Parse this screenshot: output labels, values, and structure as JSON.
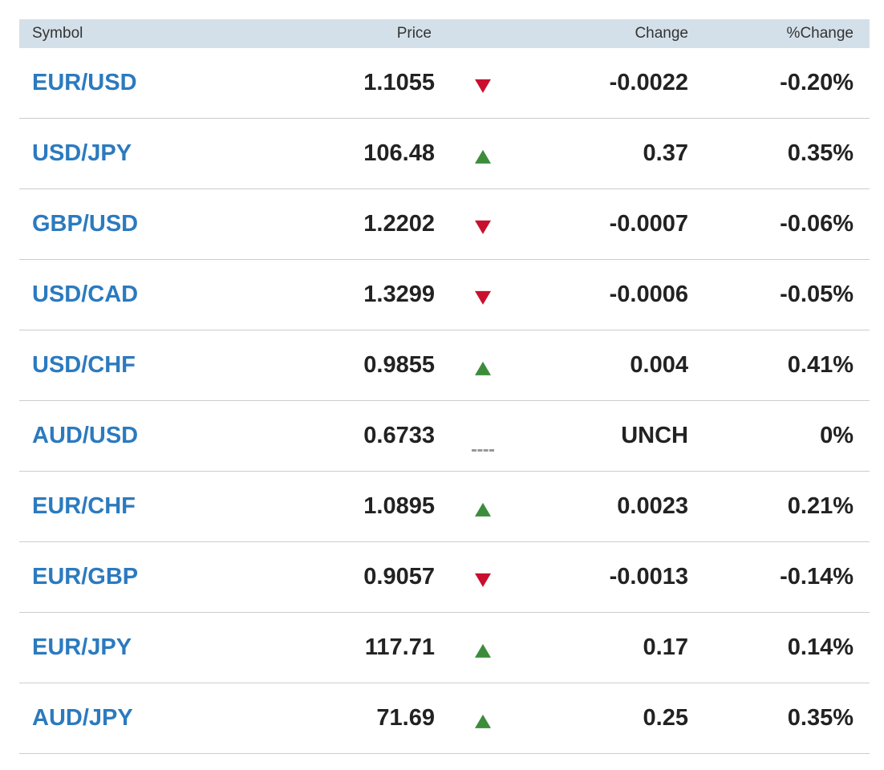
{
  "table": {
    "headers": {
      "symbol": "Symbol",
      "price": "Price",
      "change": "Change",
      "pct_change": "%Change"
    },
    "colors": {
      "header_bg": "#d4e0e9",
      "symbol_link": "#2b7abf",
      "down": "#c8102e",
      "up": "#3c8c3c",
      "unchanged": "#999999"
    },
    "rows": [
      {
        "symbol": "EUR/USD",
        "price": "1.1055",
        "direction": "down",
        "change": "-0.0022",
        "pct_change": "-0.20%"
      },
      {
        "symbol": "USD/JPY",
        "price": "106.48",
        "direction": "up",
        "change": "0.37",
        "pct_change": "0.35%"
      },
      {
        "symbol": "GBP/USD",
        "price": "1.2202",
        "direction": "down",
        "change": "-0.0007",
        "pct_change": "-0.06%"
      },
      {
        "symbol": "USD/CAD",
        "price": "1.3299",
        "direction": "down",
        "change": "-0.0006",
        "pct_change": "-0.05%"
      },
      {
        "symbol": "USD/CHF",
        "price": "0.9855",
        "direction": "up",
        "change": "0.004",
        "pct_change": "0.41%"
      },
      {
        "symbol": "AUD/USD",
        "price": "0.6733",
        "direction": "unchanged",
        "change": "UNCH",
        "pct_change": "0%"
      },
      {
        "symbol": "EUR/CHF",
        "price": "1.0895",
        "direction": "up",
        "change": "0.0023",
        "pct_change": "0.21%"
      },
      {
        "symbol": "EUR/GBP",
        "price": "0.9057",
        "direction": "down",
        "change": "-0.0013",
        "pct_change": "-0.14%"
      },
      {
        "symbol": "EUR/JPY",
        "price": "117.71",
        "direction": "up",
        "change": "0.17",
        "pct_change": "0.14%"
      },
      {
        "symbol": "AUD/JPY",
        "price": "71.69",
        "direction": "up",
        "change": "0.25",
        "pct_change": "0.35%"
      }
    ]
  }
}
